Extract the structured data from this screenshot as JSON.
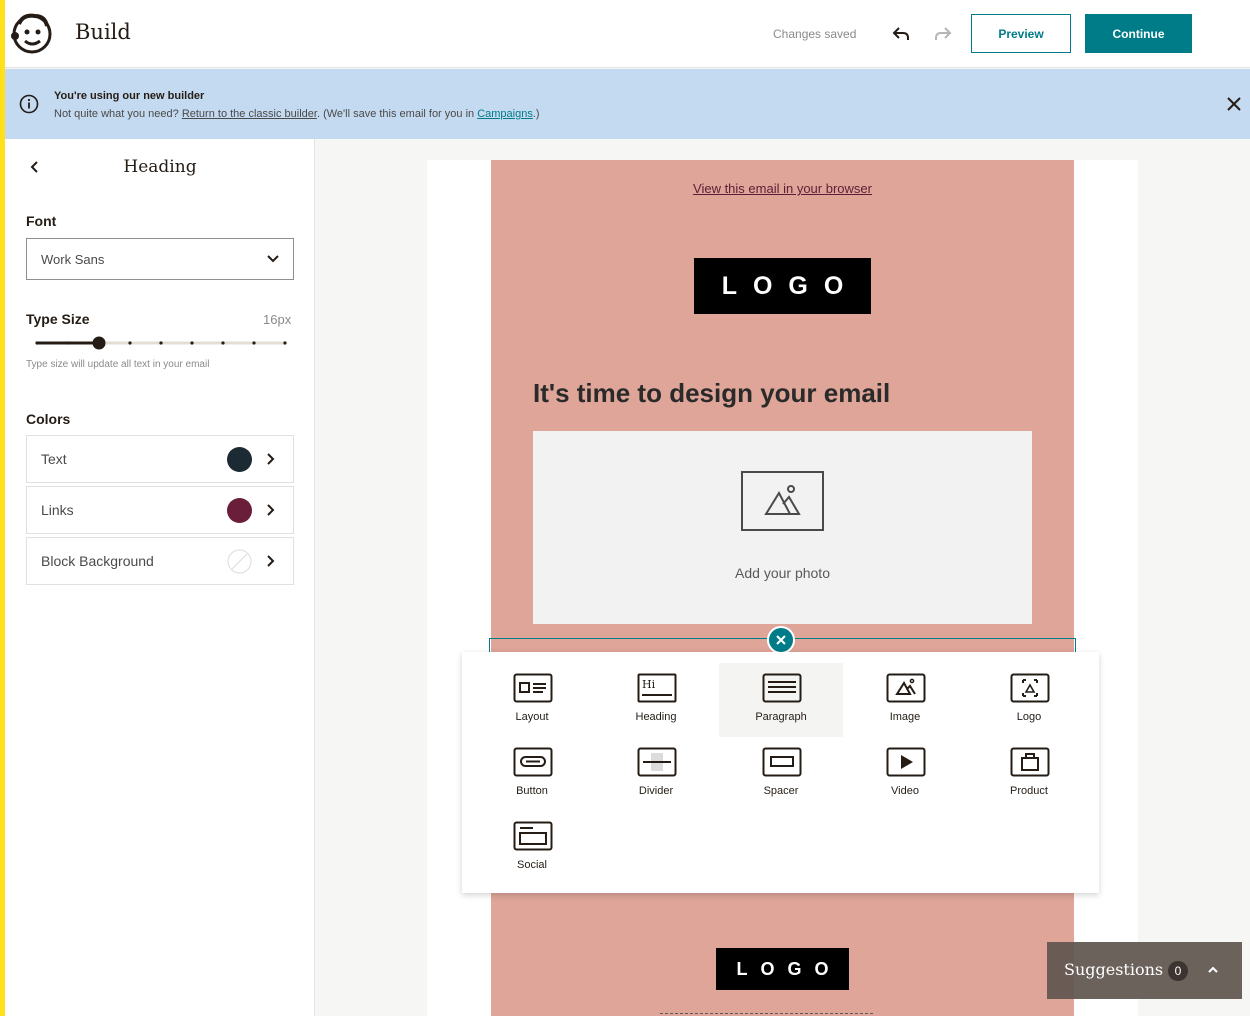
{
  "header": {
    "title": "Build",
    "status": "Changes saved",
    "preview_label": "Preview",
    "continue_label": "Continue"
  },
  "banner": {
    "title": "You're using our new builder",
    "text_before": "Not quite what you need? ",
    "classic_link": "Return to the classic builder",
    "text_middle": ". (We'll save this email for you in ",
    "campaigns_link": "Campaigns",
    "text_after": ".)"
  },
  "sidebar": {
    "title": "Heading",
    "font_label": "Font",
    "font_value": "Work Sans",
    "type_size_label": "Type Size",
    "type_size_value": "16px",
    "type_size_step": 2,
    "type_size_steps": 9,
    "type_size_hint": "Type size will update all text in your email",
    "colors_label": "Colors",
    "colors": [
      {
        "label": "Text",
        "color": "#1c2a33"
      },
      {
        "label": "Links",
        "color": "#6b1e3a"
      },
      {
        "label": "Block Background",
        "color": "none"
      }
    ]
  },
  "email": {
    "view_in_browser": "View this email in your browser",
    "logo_text": "LOGO",
    "heading": "It's time to design your email",
    "photo_label": "Add your photo",
    "background_color": "#dea598"
  },
  "blocks": [
    {
      "label": "Layout",
      "icon": "layout-icon"
    },
    {
      "label": "Heading",
      "icon": "heading-icon"
    },
    {
      "label": "Paragraph",
      "icon": "paragraph-icon"
    },
    {
      "label": "Image",
      "icon": "image-icon"
    },
    {
      "label": "Logo",
      "icon": "logo-icon"
    },
    {
      "label": "Button",
      "icon": "button-icon"
    },
    {
      "label": "Divider",
      "icon": "divider-icon"
    },
    {
      "label": "Spacer",
      "icon": "spacer-icon"
    },
    {
      "label": "Video",
      "icon": "video-icon"
    },
    {
      "label": "Product",
      "icon": "product-icon"
    },
    {
      "label": "Social",
      "icon": "social-icon"
    }
  ],
  "suggestions": {
    "label": "Suggestions",
    "count": "0"
  },
  "colors": {
    "accent": "#007c89",
    "banner": "#c4daf0",
    "brand_stripe": "#ffe01b"
  }
}
